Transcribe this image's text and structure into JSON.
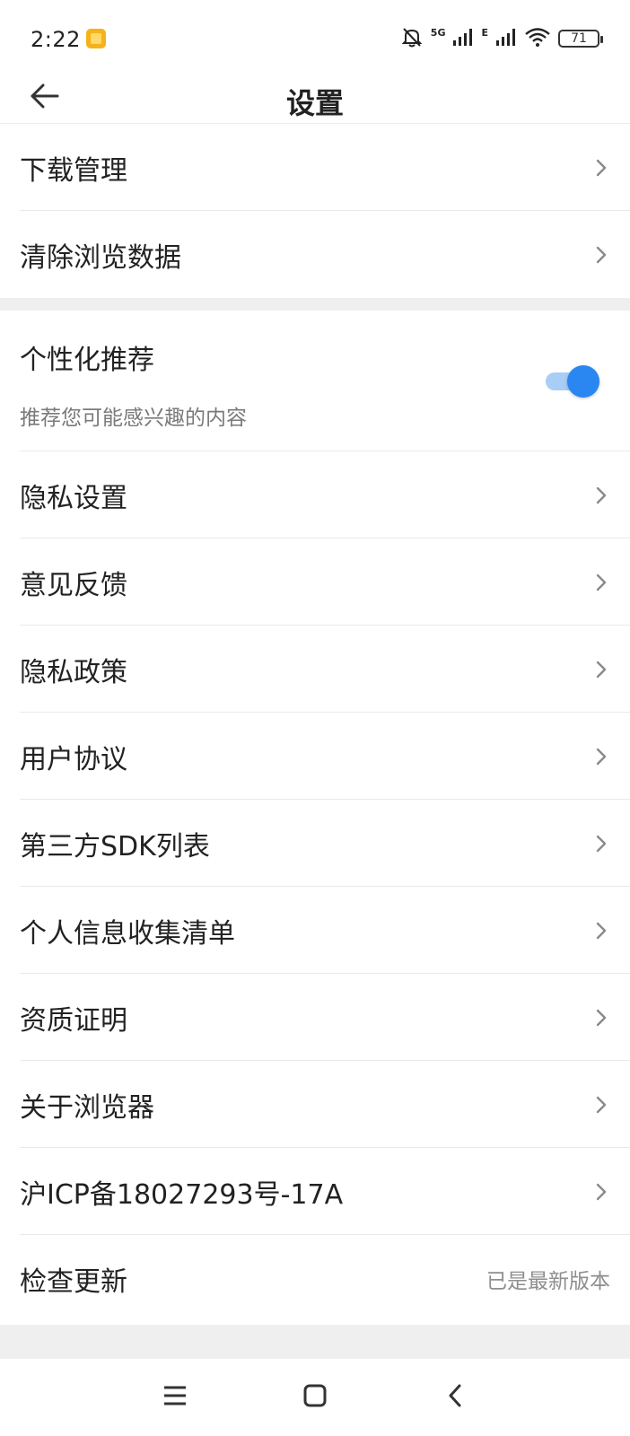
{
  "status_bar": {
    "time": "2:22",
    "network_5g": "5G",
    "network_e": "E",
    "battery": "71"
  },
  "header": {
    "title": "设置"
  },
  "group1": [
    {
      "label": "下载管理"
    },
    {
      "label": "清除浏览数据"
    }
  ],
  "personalized": {
    "title": "个性化推荐",
    "subtitle": "推荐您可能感兴趣的内容",
    "enabled": true
  },
  "group2": [
    {
      "label": "隐私设置"
    },
    {
      "label": "意见反馈"
    },
    {
      "label": "隐私政策"
    },
    {
      "label": "用户协议"
    },
    {
      "label": "第三方SDK列表"
    },
    {
      "label": "个人信息收集清单"
    },
    {
      "label": "资质证明"
    },
    {
      "label": "关于浏览器"
    },
    {
      "label": "沪ICP备18027293号-17A"
    }
  ],
  "update": {
    "label": "检查更新",
    "value": "已是最新版本"
  },
  "colors": {
    "accent": "#2a86f0",
    "section_bg": "#efefef"
  }
}
